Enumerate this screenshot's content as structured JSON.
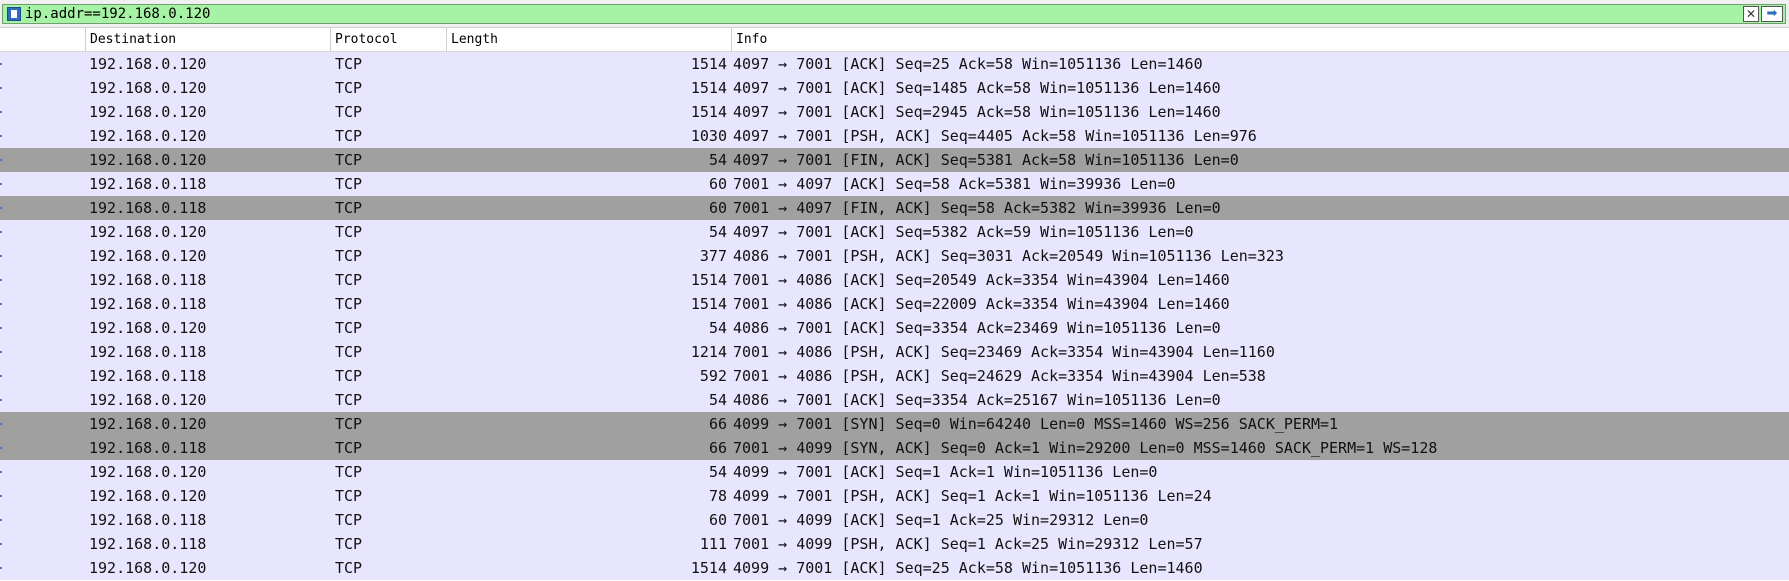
{
  "filter": {
    "value": "ip.addr==192.168.0.120"
  },
  "columns": {
    "destination": "Destination",
    "protocol": "Protocol",
    "length": "Length",
    "info": "Info"
  },
  "rows": [
    {
      "dst": "192.168.0.120",
      "proto": "TCP",
      "len": "1514",
      "info": "4097 → 7001 [ACK] Seq=25 Ack=58 Win=1051136 Len=1460",
      "dark": false
    },
    {
      "dst": "192.168.0.120",
      "proto": "TCP",
      "len": "1514",
      "info": "4097 → 7001 [ACK] Seq=1485 Ack=58 Win=1051136 Len=1460",
      "dark": false
    },
    {
      "dst": "192.168.0.120",
      "proto": "TCP",
      "len": "1514",
      "info": "4097 → 7001 [ACK] Seq=2945 Ack=58 Win=1051136 Len=1460",
      "dark": false
    },
    {
      "dst": "192.168.0.120",
      "proto": "TCP",
      "len": "1030",
      "info": "4097 → 7001 [PSH, ACK] Seq=4405 Ack=58 Win=1051136 Len=976",
      "dark": false
    },
    {
      "dst": "192.168.0.120",
      "proto": "TCP",
      "len": "54",
      "info": "4097 → 7001 [FIN, ACK] Seq=5381 Ack=58 Win=1051136 Len=0",
      "dark": true
    },
    {
      "dst": "192.168.0.118",
      "proto": "TCP",
      "len": "60",
      "info": "7001 → 4097 [ACK] Seq=58 Ack=5381 Win=39936 Len=0",
      "dark": false
    },
    {
      "dst": "192.168.0.118",
      "proto": "TCP",
      "len": "60",
      "info": "7001 → 4097 [FIN, ACK] Seq=58 Ack=5382 Win=39936 Len=0",
      "dark": true
    },
    {
      "dst": "192.168.0.120",
      "proto": "TCP",
      "len": "54",
      "info": "4097 → 7001 [ACK] Seq=5382 Ack=59 Win=1051136 Len=0",
      "dark": false
    },
    {
      "dst": "192.168.0.120",
      "proto": "TCP",
      "len": "377",
      "info": "4086 → 7001 [PSH, ACK] Seq=3031 Ack=20549 Win=1051136 Len=323",
      "dark": false
    },
    {
      "dst": "192.168.0.118",
      "proto": "TCP",
      "len": "1514",
      "info": "7001 → 4086 [ACK] Seq=20549 Ack=3354 Win=43904 Len=1460",
      "dark": false
    },
    {
      "dst": "192.168.0.118",
      "proto": "TCP",
      "len": "1514",
      "info": "7001 → 4086 [ACK] Seq=22009 Ack=3354 Win=43904 Len=1460",
      "dark": false
    },
    {
      "dst": "192.168.0.120",
      "proto": "TCP",
      "len": "54",
      "info": "4086 → 7001 [ACK] Seq=3354 Ack=23469 Win=1051136 Len=0",
      "dark": false
    },
    {
      "dst": "192.168.0.118",
      "proto": "TCP",
      "len": "1214",
      "info": "7001 → 4086 [PSH, ACK] Seq=23469 Ack=3354 Win=43904 Len=1160",
      "dark": false
    },
    {
      "dst": "192.168.0.118",
      "proto": "TCP",
      "len": "592",
      "info": "7001 → 4086 [PSH, ACK] Seq=24629 Ack=3354 Win=43904 Len=538",
      "dark": false
    },
    {
      "dst": "192.168.0.120",
      "proto": "TCP",
      "len": "54",
      "info": "4086 → 7001 [ACK] Seq=3354 Ack=25167 Win=1051136 Len=0",
      "dark": false
    },
    {
      "dst": "192.168.0.120",
      "proto": "TCP",
      "len": "66",
      "info": "4099 → 7001 [SYN] Seq=0 Win=64240 Len=0 MSS=1460 WS=256 SACK_PERM=1",
      "dark": true
    },
    {
      "dst": "192.168.0.118",
      "proto": "TCP",
      "len": "66",
      "info": "7001 → 4099 [SYN, ACK] Seq=0 Ack=1 Win=29200 Len=0 MSS=1460 SACK_PERM=1 WS=128",
      "dark": true
    },
    {
      "dst": "192.168.0.120",
      "proto": "TCP",
      "len": "54",
      "info": "4099 → 7001 [ACK] Seq=1 Ack=1 Win=1051136 Len=0",
      "dark": false
    },
    {
      "dst": "192.168.0.120",
      "proto": "TCP",
      "len": "78",
      "info": "4099 → 7001 [PSH, ACK] Seq=1 Ack=1 Win=1051136 Len=24",
      "dark": false
    },
    {
      "dst": "192.168.0.118",
      "proto": "TCP",
      "len": "60",
      "info": "7001 → 4099 [ACK] Seq=1 Ack=25 Win=29312 Len=0",
      "dark": false
    },
    {
      "dst": "192.168.0.118",
      "proto": "TCP",
      "len": "111",
      "info": "7001 → 4099 [PSH, ACK] Seq=1 Ack=25 Win=29312 Len=57",
      "dark": false
    },
    {
      "dst": "192.168.0.120",
      "proto": "TCP",
      "len": "1514",
      "info": "4099 → 7001 [ACK] Seq=25 Ack=58 Win=1051136 Len=1460",
      "dark": false
    }
  ]
}
